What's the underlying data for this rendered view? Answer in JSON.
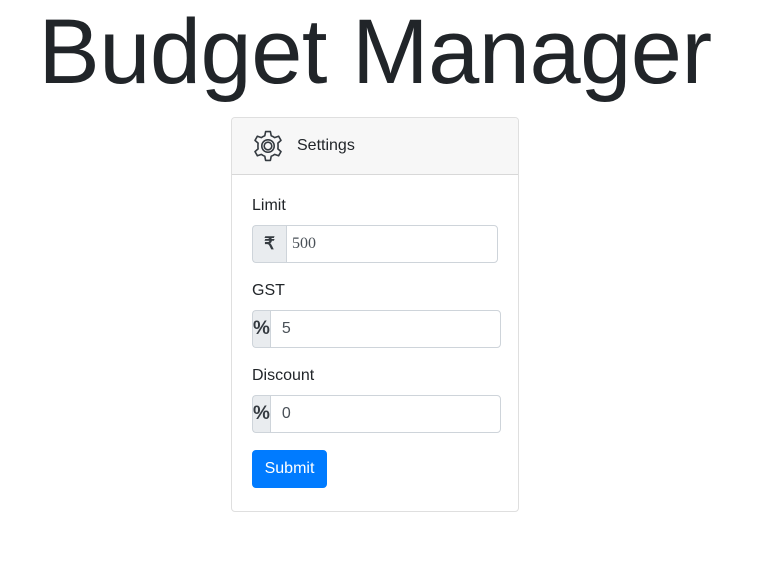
{
  "app": {
    "title": "Budget Manager"
  },
  "settings_card": {
    "header_label": "Settings",
    "header_icon": "gear-icon",
    "fields": {
      "limit": {
        "label": "Limit",
        "prefix_symbol": "₹",
        "value": "500"
      },
      "gst": {
        "label": "GST",
        "prefix_symbol": "%",
        "value": "5"
      },
      "discount": {
        "label": "Discount",
        "prefix_symbol": "%",
        "value": "0"
      }
    },
    "submit_label": "Submit"
  },
  "colors": {
    "primary": "#007bff",
    "text": "#212529",
    "addon_bg": "#e9ecef",
    "border": "#ced4da"
  }
}
